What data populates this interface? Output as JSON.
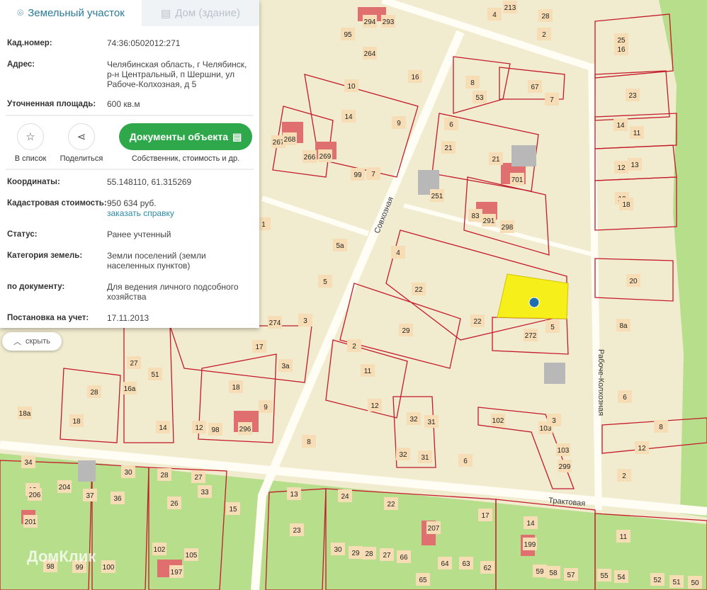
{
  "tabs": [
    {
      "label": "Земельный участок",
      "icon": "map-pin-icon"
    },
    {
      "label": "Дом (здание)",
      "icon": "building-icon"
    }
  ],
  "info": {
    "cad_label": "Кад.номер:",
    "cad_value": "74:36:0502012:271",
    "addr_label": "Адрес:",
    "addr_value": "Челябинская область, г Челябинск, р-н Центральный, п Шершни, ул Рабоче-Колхозная, д 5",
    "area_label": "Уточненная площадь:",
    "area_value": "600 кв.м",
    "coords_label": "Координаты:",
    "coords_value": "55.148110, 61.315269",
    "cost_label": "Кадастровая стоимость:",
    "cost_value": "950 634 руб.",
    "cost_link": "заказать справку",
    "status_label": "Статус:",
    "status_value": "Ранее учтенный",
    "cat_label": "Категория земель:",
    "cat_value": "Земли поселений (земли населенных пунктов)",
    "doc_label": "по документу:",
    "doc_value": "Для ведения личного подсобного хозяйства",
    "reg_label": "Постановка на учет:",
    "reg_value": "17.11.2013"
  },
  "actions": {
    "list": "В список",
    "share": "Поделиться",
    "docs": "Документы объекта",
    "docs_sub": "Собственник, стоимость и др."
  },
  "hide": "скрыть",
  "watermark": "ДомКлик",
  "streets": {
    "s1": "Совхозная",
    "s2": "Рабоче-Колхозная",
    "s3": "Трактовая"
  },
  "parcels": [
    "95",
    "264",
    "294",
    "293",
    "16",
    "213",
    "4",
    "28",
    "2",
    "25",
    "16",
    "10",
    "14",
    "9",
    "8",
    "53",
    "67",
    "7",
    "23",
    "14",
    "11",
    "267",
    "268",
    "266",
    "269",
    "99",
    "7",
    "6",
    "21",
    "21",
    "701",
    "12",
    "13",
    "251",
    "83",
    "291",
    "298",
    "10",
    "18",
    "5а",
    "1",
    "4",
    "22",
    "5",
    "20",
    "22",
    "29",
    "272",
    "5",
    "8а",
    "274",
    "3",
    "17",
    "2",
    "3а",
    "11",
    "27",
    "51",
    "28",
    "16а",
    "18а",
    "18",
    "14",
    "12",
    "98",
    "296",
    "18",
    "9",
    "8",
    "12",
    "32",
    "31",
    "102",
    "103",
    "3",
    "6",
    "8",
    "12",
    "32",
    "31",
    "6",
    "103",
    "299",
    "2",
    "12",
    "34",
    "206",
    "204",
    "37",
    "36",
    "30",
    "28",
    "27",
    "33",
    "26",
    "15",
    "201",
    "102",
    "105",
    "197",
    "98",
    "99",
    "100",
    "13",
    "23",
    "24",
    "22",
    "207",
    "17",
    "14",
    "199",
    "30",
    "29",
    "28",
    "27",
    "66",
    "65",
    "64",
    "63",
    "62",
    "11",
    "59",
    "58",
    "57",
    "55",
    "54",
    "52",
    "51",
    "50"
  ],
  "colors": {
    "selected": "#f7ef1a",
    "parcel": "#c41a2a",
    "green": "#b7de8a",
    "accent": "#2ea84a"
  }
}
